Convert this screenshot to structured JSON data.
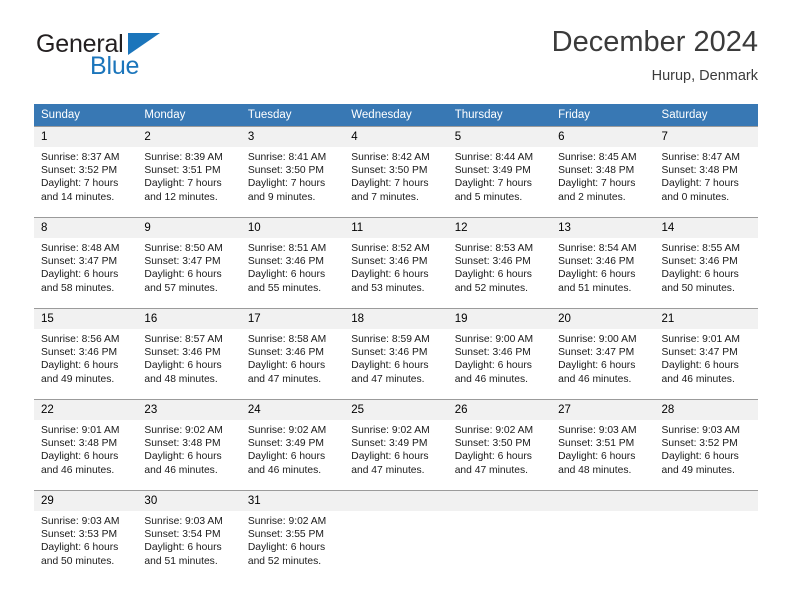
{
  "logo": {
    "word1": "General",
    "word2": "Blue",
    "triangle_color": "#1b75bb",
    "text_color": "#231f20"
  },
  "header": {
    "title": "December 2024",
    "subtitle": "Hurup, Denmark"
  },
  "theme": {
    "header_bg": "#3878b4",
    "header_text": "#ffffff",
    "daynum_bg": "#f1f1f1",
    "row_divider": "#9b9b9b"
  },
  "weekday_headers": [
    "Sunday",
    "Monday",
    "Tuesday",
    "Wednesday",
    "Thursday",
    "Friday",
    "Saturday"
  ],
  "weeks": [
    [
      {
        "day": "1",
        "sunrise": "Sunrise: 8:37 AM",
        "sunset": "Sunset: 3:52 PM",
        "daylight1": "Daylight: 7 hours",
        "daylight2": "and 14 minutes."
      },
      {
        "day": "2",
        "sunrise": "Sunrise: 8:39 AM",
        "sunset": "Sunset: 3:51 PM",
        "daylight1": "Daylight: 7 hours",
        "daylight2": "and 12 minutes."
      },
      {
        "day": "3",
        "sunrise": "Sunrise: 8:41 AM",
        "sunset": "Sunset: 3:50 PM",
        "daylight1": "Daylight: 7 hours",
        "daylight2": "and 9 minutes."
      },
      {
        "day": "4",
        "sunrise": "Sunrise: 8:42 AM",
        "sunset": "Sunset: 3:50 PM",
        "daylight1": "Daylight: 7 hours",
        "daylight2": "and 7 minutes."
      },
      {
        "day": "5",
        "sunrise": "Sunrise: 8:44 AM",
        "sunset": "Sunset: 3:49 PM",
        "daylight1": "Daylight: 7 hours",
        "daylight2": "and 5 minutes."
      },
      {
        "day": "6",
        "sunrise": "Sunrise: 8:45 AM",
        "sunset": "Sunset: 3:48 PM",
        "daylight1": "Daylight: 7 hours",
        "daylight2": "and 2 minutes."
      },
      {
        "day": "7",
        "sunrise": "Sunrise: 8:47 AM",
        "sunset": "Sunset: 3:48 PM",
        "daylight1": "Daylight: 7 hours",
        "daylight2": "and 0 minutes."
      }
    ],
    [
      {
        "day": "8",
        "sunrise": "Sunrise: 8:48 AM",
        "sunset": "Sunset: 3:47 PM",
        "daylight1": "Daylight: 6 hours",
        "daylight2": "and 58 minutes."
      },
      {
        "day": "9",
        "sunrise": "Sunrise: 8:50 AM",
        "sunset": "Sunset: 3:47 PM",
        "daylight1": "Daylight: 6 hours",
        "daylight2": "and 57 minutes."
      },
      {
        "day": "10",
        "sunrise": "Sunrise: 8:51 AM",
        "sunset": "Sunset: 3:46 PM",
        "daylight1": "Daylight: 6 hours",
        "daylight2": "and 55 minutes."
      },
      {
        "day": "11",
        "sunrise": "Sunrise: 8:52 AM",
        "sunset": "Sunset: 3:46 PM",
        "daylight1": "Daylight: 6 hours",
        "daylight2": "and 53 minutes."
      },
      {
        "day": "12",
        "sunrise": "Sunrise: 8:53 AM",
        "sunset": "Sunset: 3:46 PM",
        "daylight1": "Daylight: 6 hours",
        "daylight2": "and 52 minutes."
      },
      {
        "day": "13",
        "sunrise": "Sunrise: 8:54 AM",
        "sunset": "Sunset: 3:46 PM",
        "daylight1": "Daylight: 6 hours",
        "daylight2": "and 51 minutes."
      },
      {
        "day": "14",
        "sunrise": "Sunrise: 8:55 AM",
        "sunset": "Sunset: 3:46 PM",
        "daylight1": "Daylight: 6 hours",
        "daylight2": "and 50 minutes."
      }
    ],
    [
      {
        "day": "15",
        "sunrise": "Sunrise: 8:56 AM",
        "sunset": "Sunset: 3:46 PM",
        "daylight1": "Daylight: 6 hours",
        "daylight2": "and 49 minutes."
      },
      {
        "day": "16",
        "sunrise": "Sunrise: 8:57 AM",
        "sunset": "Sunset: 3:46 PM",
        "daylight1": "Daylight: 6 hours",
        "daylight2": "and 48 minutes."
      },
      {
        "day": "17",
        "sunrise": "Sunrise: 8:58 AM",
        "sunset": "Sunset: 3:46 PM",
        "daylight1": "Daylight: 6 hours",
        "daylight2": "and 47 minutes."
      },
      {
        "day": "18",
        "sunrise": "Sunrise: 8:59 AM",
        "sunset": "Sunset: 3:46 PM",
        "daylight1": "Daylight: 6 hours",
        "daylight2": "and 47 minutes."
      },
      {
        "day": "19",
        "sunrise": "Sunrise: 9:00 AM",
        "sunset": "Sunset: 3:46 PM",
        "daylight1": "Daylight: 6 hours",
        "daylight2": "and 46 minutes."
      },
      {
        "day": "20",
        "sunrise": "Sunrise: 9:00 AM",
        "sunset": "Sunset: 3:47 PM",
        "daylight1": "Daylight: 6 hours",
        "daylight2": "and 46 minutes."
      },
      {
        "day": "21",
        "sunrise": "Sunrise: 9:01 AM",
        "sunset": "Sunset: 3:47 PM",
        "daylight1": "Daylight: 6 hours",
        "daylight2": "and 46 minutes."
      }
    ],
    [
      {
        "day": "22",
        "sunrise": "Sunrise: 9:01 AM",
        "sunset": "Sunset: 3:48 PM",
        "daylight1": "Daylight: 6 hours",
        "daylight2": "and 46 minutes."
      },
      {
        "day": "23",
        "sunrise": "Sunrise: 9:02 AM",
        "sunset": "Sunset: 3:48 PM",
        "daylight1": "Daylight: 6 hours",
        "daylight2": "and 46 minutes."
      },
      {
        "day": "24",
        "sunrise": "Sunrise: 9:02 AM",
        "sunset": "Sunset: 3:49 PM",
        "daylight1": "Daylight: 6 hours",
        "daylight2": "and 46 minutes."
      },
      {
        "day": "25",
        "sunrise": "Sunrise: 9:02 AM",
        "sunset": "Sunset: 3:49 PM",
        "daylight1": "Daylight: 6 hours",
        "daylight2": "and 47 minutes."
      },
      {
        "day": "26",
        "sunrise": "Sunrise: 9:02 AM",
        "sunset": "Sunset: 3:50 PM",
        "daylight1": "Daylight: 6 hours",
        "daylight2": "and 47 minutes."
      },
      {
        "day": "27",
        "sunrise": "Sunrise: 9:03 AM",
        "sunset": "Sunset: 3:51 PM",
        "daylight1": "Daylight: 6 hours",
        "daylight2": "and 48 minutes."
      },
      {
        "day": "28",
        "sunrise": "Sunrise: 9:03 AM",
        "sunset": "Sunset: 3:52 PM",
        "daylight1": "Daylight: 6 hours",
        "daylight2": "and 49 minutes."
      }
    ],
    [
      {
        "day": "29",
        "sunrise": "Sunrise: 9:03 AM",
        "sunset": "Sunset: 3:53 PM",
        "daylight1": "Daylight: 6 hours",
        "daylight2": "and 50 minutes."
      },
      {
        "day": "30",
        "sunrise": "Sunrise: 9:03 AM",
        "sunset": "Sunset: 3:54 PM",
        "daylight1": "Daylight: 6 hours",
        "daylight2": "and 51 minutes."
      },
      {
        "day": "31",
        "sunrise": "Sunrise: 9:02 AM",
        "sunset": "Sunset: 3:55 PM",
        "daylight1": "Daylight: 6 hours",
        "daylight2": "and 52 minutes."
      },
      {
        "day": "",
        "sunrise": "",
        "sunset": "",
        "daylight1": "",
        "daylight2": ""
      },
      {
        "day": "",
        "sunrise": "",
        "sunset": "",
        "daylight1": "",
        "daylight2": ""
      },
      {
        "day": "",
        "sunrise": "",
        "sunset": "",
        "daylight1": "",
        "daylight2": ""
      },
      {
        "day": "",
        "sunrise": "",
        "sunset": "",
        "daylight1": "",
        "daylight2": ""
      }
    ]
  ]
}
